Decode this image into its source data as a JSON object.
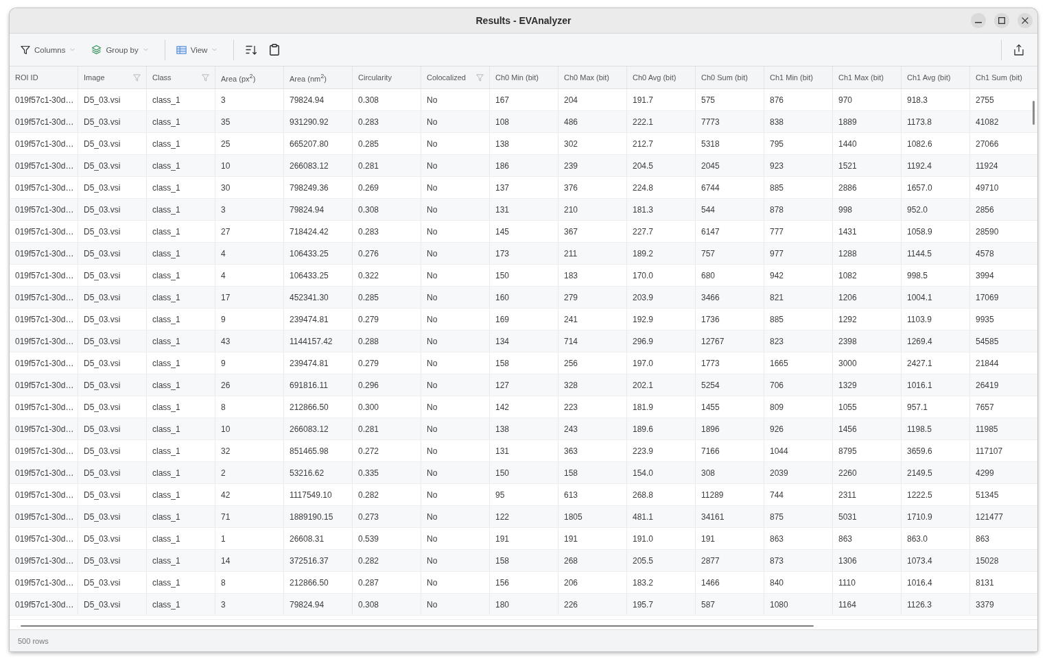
{
  "window": {
    "title": "Results - EVAnalyzer"
  },
  "toolbar": {
    "left": [
      {
        "kind": "dropdown",
        "label": "Columns"
      },
      {
        "kind": "dropdown",
        "label": "Group by"
      },
      {
        "kind": "separator"
      },
      {
        "kind": "dropdown",
        "label": "View"
      },
      {
        "kind": "separator"
      },
      {
        "kind": "sort"
      },
      {
        "kind": "clipboard"
      }
    ],
    "right": [
      {
        "kind": "separator"
      },
      {
        "kind": "export"
      }
    ]
  },
  "table": {
    "columns": [
      {
        "label": "ROI ID",
        "filter": false
      },
      {
        "label": "Image",
        "filter": true
      },
      {
        "label": "Class",
        "filter": true
      },
      {
        "label": "Area (px$^{2}$)",
        "filter": false
      },
      {
        "label": "Area (nm$^{2}$)",
        "filter": false
      },
      {
        "label": "Circularity",
        "filter": false
      },
      {
        "label": "Colocalized",
        "filter": true
      },
      {
        "label": "Ch0 Min (bit)",
        "filter": false
      },
      {
        "label": "Ch0 Max (bit)",
        "filter": false
      },
      {
        "label": "Ch0 Avg (bit)",
        "filter": false
      },
      {
        "label": "Ch0 Sum (bit)",
        "filter": false
      },
      {
        "label": "Ch1 Min (bit)",
        "filter": false
      },
      {
        "label": "Ch1 Max (bit)",
        "filter": false
      },
      {
        "label": "Ch1 Avg (bit)",
        "filter": false
      },
      {
        "label": "Ch1 Sum (bit)",
        "filter": false
      }
    ],
    "rows": [
      {
        "cells": [
          "019f57c1-30d…",
          "D5_03.vsi",
          "class_1",
          "3",
          "79824.94",
          "0.308",
          "No",
          "167",
          "204",
          "191.7",
          "575",
          "876",
          "970",
          "918.3",
          "2755"
        ]
      },
      {
        "cells": [
          "019f57c1-30d…",
          "D5_03.vsi",
          "class_1",
          "35",
          "931290.92",
          "0.283",
          "No",
          "108",
          "486",
          "222.1",
          "7773",
          "838",
          "1889",
          "1173.8",
          "41082"
        ]
      },
      {
        "cells": [
          "019f57c1-30d…",
          "D5_03.vsi",
          "class_1",
          "25",
          "665207.80",
          "0.285",
          "No",
          "138",
          "302",
          "212.7",
          "5318",
          "795",
          "1440",
          "1082.6",
          "27066"
        ]
      },
      {
        "cells": [
          "019f57c1-30d…",
          "D5_03.vsi",
          "class_1",
          "10",
          "266083.12",
          "0.281",
          "No",
          "186",
          "239",
          "204.5",
          "2045",
          "923",
          "1521",
          "1192.4",
          "11924"
        ]
      },
      {
        "cells": [
          "019f57c1-30d…",
          "D5_03.vsi",
          "class_1",
          "30",
          "798249.36",
          "0.269",
          "No",
          "137",
          "376",
          "224.8",
          "6744",
          "885",
          "2886",
          "1657.0",
          "49710"
        ]
      },
      {
        "cells": [
          "019f57c1-30d…",
          "D5_03.vsi",
          "class_1",
          "3",
          "79824.94",
          "0.308",
          "No",
          "131",
          "210",
          "181.3",
          "544",
          "878",
          "998",
          "952.0",
          "2856"
        ]
      },
      {
        "cells": [
          "019f57c1-30d…",
          "D5_03.vsi",
          "class_1",
          "27",
          "718424.42",
          "0.283",
          "No",
          "145",
          "367",
          "227.7",
          "6147",
          "777",
          "1431",
          "1058.9",
          "28590"
        ]
      },
      {
        "cells": [
          "019f57c1-30d…",
          "D5_03.vsi",
          "class_1",
          "4",
          "106433.25",
          "0.276",
          "No",
          "173",
          "211",
          "189.2",
          "757",
          "977",
          "1288",
          "1144.5",
          "4578"
        ]
      },
      {
        "cells": [
          "019f57c1-30d…",
          "D5_03.vsi",
          "class_1",
          "4",
          "106433.25",
          "0.322",
          "No",
          "150",
          "183",
          "170.0",
          "680",
          "942",
          "1082",
          "998.5",
          "3994"
        ]
      },
      {
        "cells": [
          "019f57c1-30d…",
          "D5_03.vsi",
          "class_1",
          "17",
          "452341.30",
          "0.285",
          "No",
          "160",
          "279",
          "203.9",
          "3466",
          "821",
          "1206",
          "1004.1",
          "17069"
        ]
      },
      {
        "cells": [
          "019f57c1-30d…",
          "D5_03.vsi",
          "class_1",
          "9",
          "239474.81",
          "0.279",
          "No",
          "169",
          "241",
          "192.9",
          "1736",
          "885",
          "1292",
          "1103.9",
          "9935"
        ]
      },
      {
        "cells": [
          "019f57c1-30d…",
          "D5_03.vsi",
          "class_1",
          "43",
          "1144157.42",
          "0.288",
          "No",
          "134",
          "714",
          "296.9",
          "12767",
          "823",
          "2398",
          "1269.4",
          "54585"
        ]
      },
      {
        "cells": [
          "019f57c1-30d…",
          "D5_03.vsi",
          "class_1",
          "9",
          "239474.81",
          "0.279",
          "No",
          "158",
          "256",
          "197.0",
          "1773",
          "1665",
          "3000",
          "2427.1",
          "21844"
        ]
      },
      {
        "cells": [
          "019f57c1-30d…",
          "D5_03.vsi",
          "class_1",
          "26",
          "691816.11",
          "0.296",
          "No",
          "127",
          "328",
          "202.1",
          "5254",
          "706",
          "1329",
          "1016.1",
          "26419"
        ]
      },
      {
        "cells": [
          "019f57c1-30d…",
          "D5_03.vsi",
          "class_1",
          "8",
          "212866.50",
          "0.300",
          "No",
          "142",
          "223",
          "181.9",
          "1455",
          "809",
          "1055",
          "957.1",
          "7657"
        ]
      },
      {
        "cells": [
          "019f57c1-30d…",
          "D5_03.vsi",
          "class_1",
          "10",
          "266083.12",
          "0.281",
          "No",
          "138",
          "243",
          "189.6",
          "1896",
          "926",
          "1456",
          "1198.5",
          "11985"
        ]
      },
      {
        "cells": [
          "019f57c1-30d…",
          "D5_03.vsi",
          "class_1",
          "32",
          "851465.98",
          "0.272",
          "No",
          "131",
          "363",
          "223.9",
          "7166",
          "1044",
          "8795",
          "3659.6",
          "117107"
        ]
      },
      {
        "cells": [
          "019f57c1-30d…",
          "D5_03.vsi",
          "class_1",
          "2",
          "53216.62",
          "0.335",
          "No",
          "150",
          "158",
          "154.0",
          "308",
          "2039",
          "2260",
          "2149.5",
          "4299"
        ]
      },
      {
        "cells": [
          "019f57c1-30d…",
          "D5_03.vsi",
          "class_1",
          "42",
          "1117549.10",
          "0.282",
          "No",
          "95",
          "613",
          "268.8",
          "11289",
          "744",
          "2311",
          "1222.5",
          "51345"
        ]
      },
      {
        "cells": [
          "019f57c1-30d…",
          "D5_03.vsi",
          "class_1",
          "71",
          "1889190.15",
          "0.273",
          "No",
          "122",
          "1805",
          "481.1",
          "34161",
          "875",
          "5031",
          "1710.9",
          "121477"
        ]
      },
      {
        "cells": [
          "019f57c1-30d…",
          "D5_03.vsi",
          "class_1",
          "1",
          "26608.31",
          "0.539",
          "No",
          "191",
          "191",
          "191.0",
          "191",
          "863",
          "863",
          "863.0",
          "863"
        ]
      },
      {
        "cells": [
          "019f57c1-30d…",
          "D5_03.vsi",
          "class_1",
          "14",
          "372516.37",
          "0.282",
          "No",
          "158",
          "268",
          "205.5",
          "2877",
          "873",
          "1306",
          "1073.4",
          "15028"
        ]
      },
      {
        "cells": [
          "019f57c1-30d…",
          "D5_03.vsi",
          "class_1",
          "8",
          "212866.50",
          "0.287",
          "No",
          "156",
          "206",
          "183.2",
          "1466",
          "840",
          "1110",
          "1016.4",
          "8131"
        ]
      },
      {
        "cells": [
          "019f57c1-30d…",
          "D5_03.vsi",
          "class_1",
          "3",
          "79824.94",
          "0.308",
          "No",
          "180",
          "226",
          "195.7",
          "587",
          "1080",
          "1164",
          "1126.3",
          "3379"
        ]
      }
    ]
  },
  "status_bar": {
    "text": "500 rows"
  }
}
